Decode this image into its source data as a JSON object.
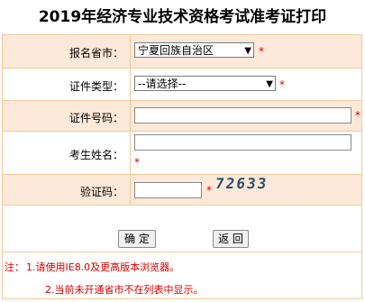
{
  "page": {
    "title": "2019年经济专业技术资格考试准考证打印"
  },
  "form": {
    "province": {
      "label": "报名省市：",
      "value": "宁夏回族自治区"
    },
    "cert_type": {
      "label": "证件类型：",
      "value": "--请选择--"
    },
    "cert_no": {
      "label": "证件号码：",
      "value": ""
    },
    "name": {
      "label": "考生姓名：",
      "value": ""
    },
    "captcha": {
      "label": "验证码：",
      "value": "",
      "image_text": "72633"
    },
    "required_mark": "*"
  },
  "buttons": {
    "confirm": "确 定",
    "back": "返 回"
  },
  "notes": {
    "prefix": "注：",
    "line1": "1.请使用IE8.0及更高版本浏览器。",
    "line2": "2.当前未开通省市不在列表中显示。"
  },
  "colors": {
    "border": "#f3c89a",
    "row_tint": "#fde9d9",
    "required": "#e00000",
    "note": "#d40000"
  }
}
